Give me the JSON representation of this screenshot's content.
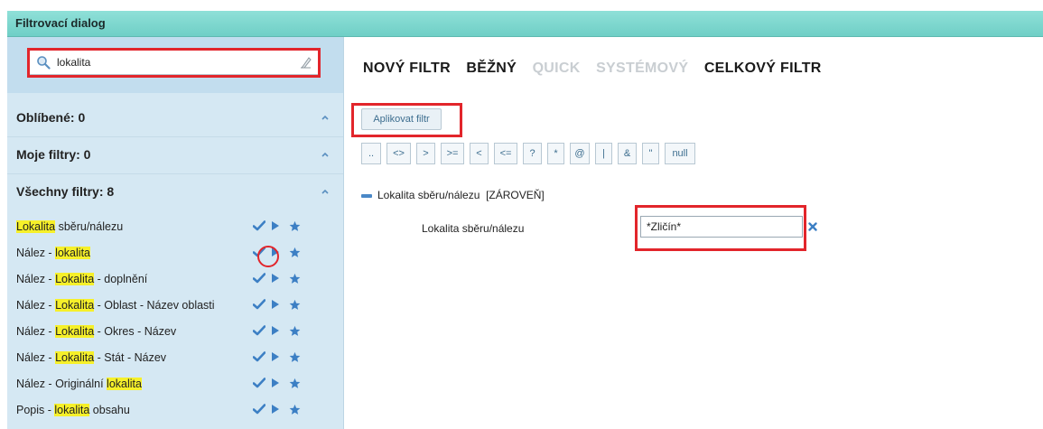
{
  "window": {
    "title": "Filtrovací dialog"
  },
  "search": {
    "value": "lokalita"
  },
  "sections": {
    "favorites": "Oblíbené: 0",
    "my_filters": "Moje filtry: 0",
    "all_filters": "Všechny filtry: 8"
  },
  "filters": [
    {
      "pre": "",
      "hl": "Lokalita",
      "post": " sběru/nálezu"
    },
    {
      "pre": "Nález - ",
      "hl": "lokalita",
      "post": ""
    },
    {
      "pre": "Nález - ",
      "hl": "Lokalita",
      "post": " - doplnění"
    },
    {
      "pre": "Nález - ",
      "hl": "Lokalita",
      "post": " - Oblast - Název oblasti"
    },
    {
      "pre": "Nález - ",
      "hl": "Lokalita",
      "post": " - Okres - Název"
    },
    {
      "pre": "Nález - ",
      "hl": "Lokalita",
      "post": " - Stát - Název"
    },
    {
      "pre": "Nález - Originální ",
      "hl": "lokalita",
      "post": ""
    },
    {
      "pre": "Popis - ",
      "hl": "lokalita",
      "post": " obsahu"
    }
  ],
  "tabs": [
    {
      "label": "NOVÝ FILTR",
      "state": "active"
    },
    {
      "label": "BĚŽNÝ",
      "state": "active"
    },
    {
      "label": "QUICK",
      "state": "disabled"
    },
    {
      "label": "SYSTÉMOVÝ",
      "state": "disabled"
    },
    {
      "label": "CELKOVÝ FILTR",
      "state": "active"
    }
  ],
  "apply_button": "Aplikovat filtr",
  "operators": [
    "..",
    "<>",
    ">",
    ">=",
    "<",
    "<=",
    "?",
    "*",
    "@",
    "|",
    "&",
    "\"",
    "null"
  ],
  "tree": {
    "label": "Lokalita sběru/nálezu",
    "mode": "[ZÁROVEŇ]"
  },
  "condition": {
    "label": "Lokalita sběru/nálezu",
    "value": "*Zličín*"
  },
  "colors": {
    "accent": "#4a88c7",
    "highlight": "#f6f02a",
    "annotation": "#e2252b",
    "title_bar": "#7fd8cf"
  }
}
